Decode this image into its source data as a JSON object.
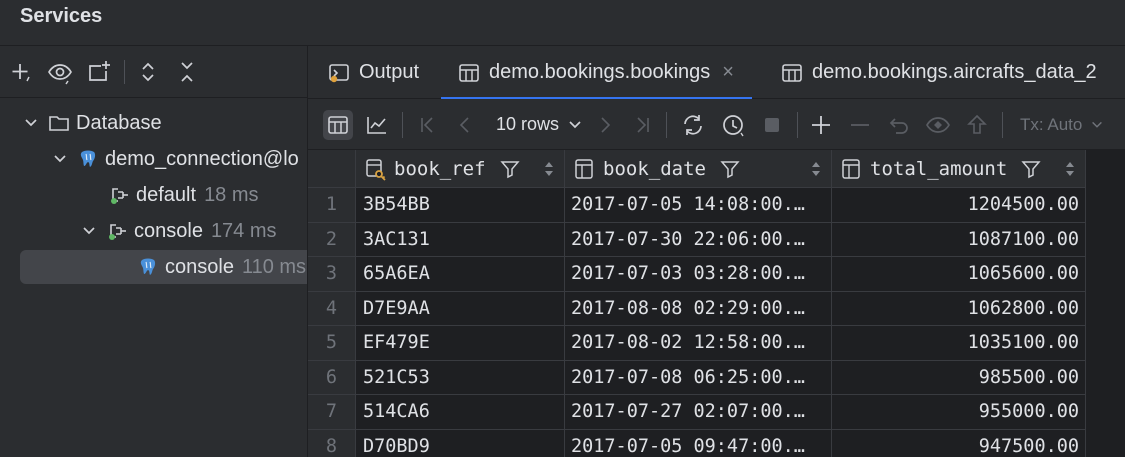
{
  "window": {
    "title": "Services"
  },
  "left_toolbar": {
    "icons": [
      "add-icon",
      "eye-icon",
      "new-session-icon",
      "expand-all-icon",
      "collapse-all-icon"
    ]
  },
  "tree": {
    "root": {
      "label": "Database"
    },
    "connection": {
      "label": "demo_connection@lo"
    },
    "default_session": {
      "label": "default",
      "time": "18 ms"
    },
    "console_group": {
      "label": "console",
      "time": "174 ms"
    },
    "console_item": {
      "label": "console",
      "time": "110 ms"
    }
  },
  "tabs": [
    {
      "label": "Output",
      "icon": "output-icon"
    },
    {
      "label": "demo.bookings.bookings",
      "icon": "table-icon",
      "active": true,
      "close": "×"
    },
    {
      "label": "demo.bookings.aircrafts_data_2",
      "icon": "table-icon"
    }
  ],
  "grid_toolbar": {
    "rows_label": "10 rows",
    "tx_label": "Tx: Auto",
    "icons": [
      "table-view-icon",
      "chart-view-icon",
      "first-page-icon",
      "prev-page-icon",
      "next-page-icon",
      "last-page-icon",
      "reload-icon",
      "history-icon",
      "stop-icon",
      "add-row-icon",
      "delete-row-icon",
      "revert-icon",
      "preview-icon",
      "submit-icon"
    ]
  },
  "table": {
    "columns": [
      {
        "name": "book_ref",
        "icon": "key-column-icon"
      },
      {
        "name": "book_date",
        "icon": "column-icon"
      },
      {
        "name": "total_amount",
        "icon": "column-icon"
      }
    ],
    "rows": [
      {
        "n": "1",
        "book_ref": "3B54BB",
        "book_date": "2017-07-05 14:08:00.…",
        "total_amount": "1204500.00"
      },
      {
        "n": "2",
        "book_ref": "3AC131",
        "book_date": "2017-07-30 22:06:00.…",
        "total_amount": "1087100.00"
      },
      {
        "n": "3",
        "book_ref": "65A6EA",
        "book_date": "2017-07-03 03:28:00.…",
        "total_amount": "1065600.00"
      },
      {
        "n": "4",
        "book_ref": "D7E9AA",
        "book_date": "2017-08-08 02:29:00.…",
        "total_amount": "1062800.00"
      },
      {
        "n": "5",
        "book_ref": "EF479E",
        "book_date": "2017-08-02 12:58:00.…",
        "total_amount": "1035100.00"
      },
      {
        "n": "6",
        "book_ref": "521C53",
        "book_date": "2017-07-08 06:25:00.…",
        "total_amount": "985500.00"
      },
      {
        "n": "7",
        "book_ref": "514CA6",
        "book_date": "2017-07-27 02:07:00.…",
        "total_amount": "955000.00"
      },
      {
        "n": "8",
        "book_ref": "D70BD9",
        "book_date": "2017-07-05 09:47:00.…",
        "total_amount": "947500.00"
      }
    ]
  },
  "colors": {
    "accent": "#3574f0",
    "status_green": "#5fb865",
    "pg_blue": "#4a90d9",
    "key_gold": "#d9a343"
  }
}
